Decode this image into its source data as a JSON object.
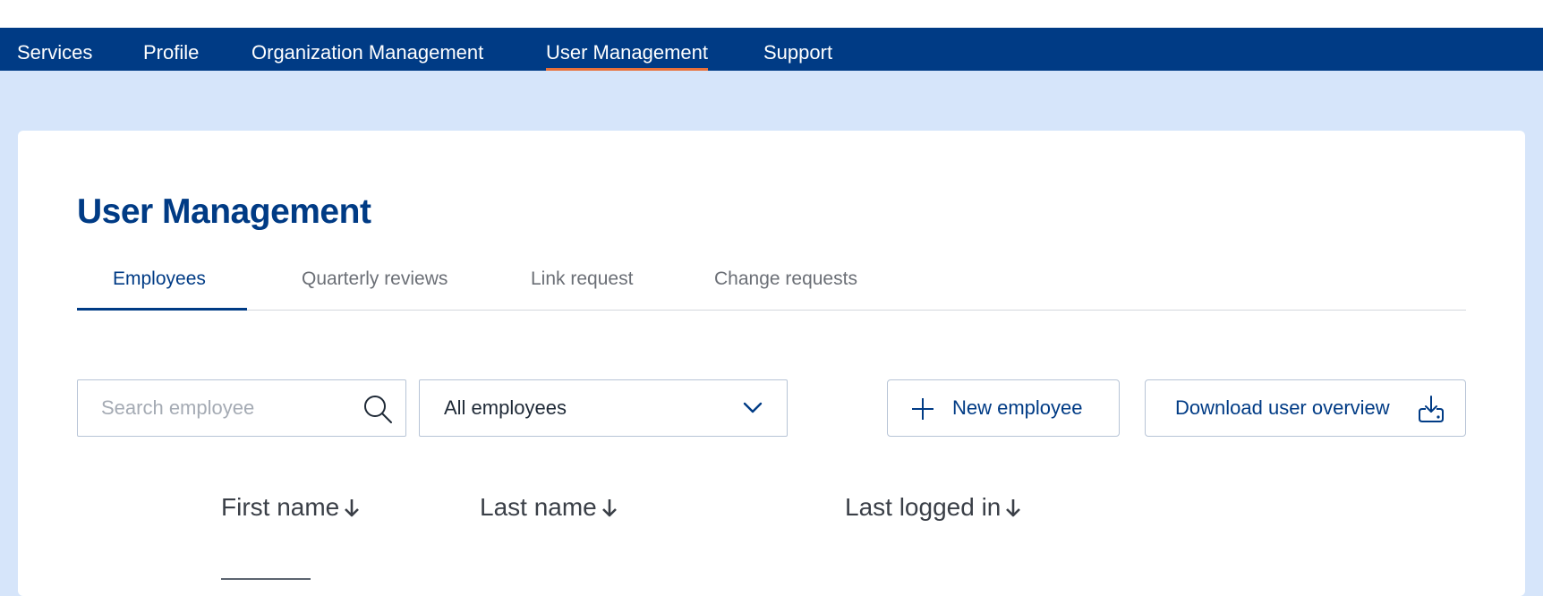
{
  "topnav": {
    "items": [
      {
        "label": "Services",
        "active": false
      },
      {
        "label": "Profile",
        "active": false
      },
      {
        "label": "Organization Management",
        "active": false
      },
      {
        "label": "User Management",
        "active": true
      },
      {
        "label": "Support",
        "active": false
      }
    ]
  },
  "page": {
    "title": "User Management"
  },
  "tabs": [
    {
      "label": "Employees",
      "active": true
    },
    {
      "label": "Quarterly reviews",
      "active": false
    },
    {
      "label": "Link request",
      "active": false
    },
    {
      "label": "Change requests",
      "active": false
    }
  ],
  "toolbar": {
    "search_placeholder": "Search employee",
    "filter_value": "All employees",
    "new_employee_label": "New employee",
    "download_label": "Download user overview"
  },
  "table": {
    "columns": [
      {
        "label": "First name",
        "sort": "descending"
      },
      {
        "label": "Last name",
        "sort": "descending"
      },
      {
        "label": "Last logged in",
        "sort": "descending"
      }
    ]
  },
  "colors": {
    "nav_bg": "#003b85",
    "nav_active_underline": "#e8703a",
    "page_bg": "#d6e5fa",
    "accent": "#003b85"
  },
  "icons": {
    "search": "search-icon",
    "dropdown": "chevron-down-icon",
    "add": "plus-icon",
    "download": "download-icon",
    "sort": "arrow-down-icon"
  }
}
